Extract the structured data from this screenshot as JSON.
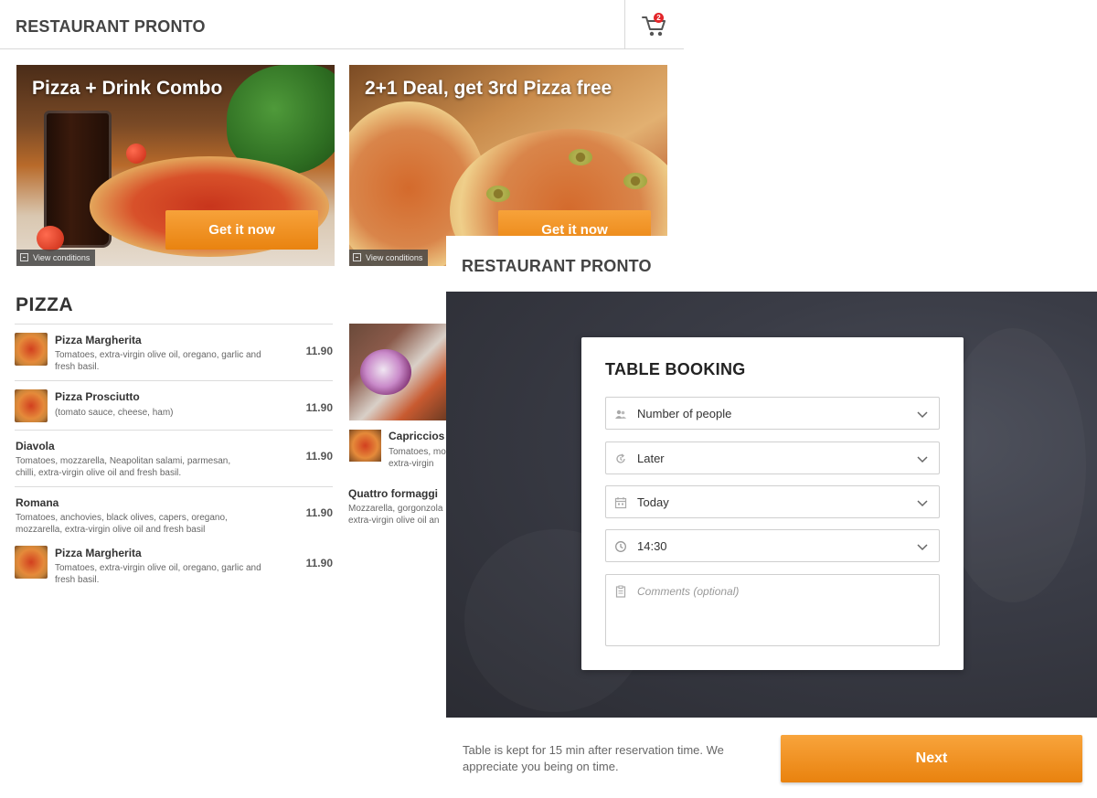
{
  "menu_screen": {
    "brand": "RESTAURANT PRONTO",
    "cart": {
      "count": "2"
    },
    "promos": [
      {
        "title": "Pizza + Drink Combo",
        "cta": "Get it now",
        "conditions": "View conditions"
      },
      {
        "title": "2+1 Deal, get 3rd Pizza free",
        "cta": "Get it now",
        "conditions": "View conditions"
      }
    ],
    "section_title": "PIZZA",
    "items": [
      {
        "name": "Pizza Margherita",
        "desc": "Tomatoes, extra-virgin olive oil, oregano, garlic and fresh basil.",
        "price": "11.90"
      },
      {
        "name": "Pizza Prosciutto",
        "desc": "(tomato sauce, cheese, ham)",
        "price": "11.90"
      },
      {
        "name": "Diavola",
        "desc": "Tomatoes, mozzarella, Neapolitan salami, parmesan, chilli, extra-virgin olive oil and fresh basil.",
        "price": "11.90"
      },
      {
        "name": "Romana",
        "desc": "Tomatoes, anchovies, black olives, capers, oregano, mozzarella, extra-virgin olive oil and fresh basil",
        "price": "11.90"
      },
      {
        "name": "Pizza Margherita",
        "desc": "Tomatoes, extra-virgin olive oil, oregano, garlic and fresh basil.",
        "price": "11.90"
      }
    ],
    "items_right": [
      {
        "name": "Capriccios",
        "desc": "Tomatoes, mo extra-virgin"
      },
      {
        "name": "Quattro formaggi",
        "desc": "Mozzarella, gorgonzola extra-virgin olive oil an"
      }
    ]
  },
  "booking_screen": {
    "brand": "RESTAURANT PRONTO",
    "card_title": "TABLE BOOKING",
    "fields": {
      "people": "Number of people",
      "time_mode": "Later",
      "date": "Today",
      "time": "14:30"
    },
    "comments_placeholder": "Comments (optional)",
    "footer_note": "Table is kept for 15 min after reservation time. We appreciate you being on time.",
    "next_label": "Next"
  },
  "colors": {
    "accent": "#f08d1f",
    "badge": "#e3262a",
    "hero": "#33343c"
  }
}
